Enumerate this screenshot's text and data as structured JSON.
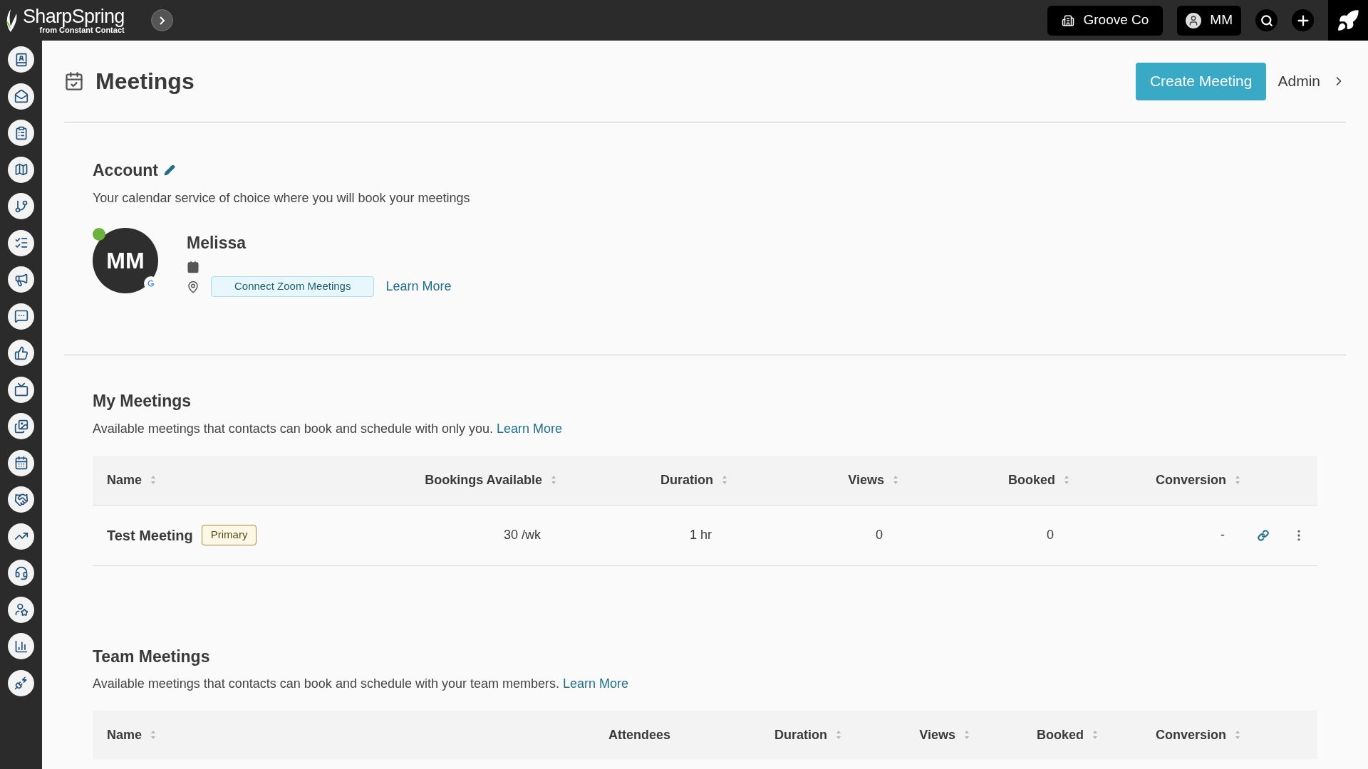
{
  "topbar": {
    "brand": "SharpSpring",
    "brand_sub": "from Constant Contact",
    "company": "Groove Co",
    "user": "MM"
  },
  "page": {
    "title": "Meetings",
    "create_button": "Create Meeting",
    "admin_link": "Admin"
  },
  "account": {
    "heading": "Account",
    "description": "Your calendar service of choice where you will book your meetings",
    "profile": {
      "initials": "MM",
      "name": "Melissa",
      "online": true,
      "connect_button": "Connect Zoom Meetings",
      "learn_more": "Learn More"
    }
  },
  "my_meetings": {
    "heading": "My Meetings",
    "description": "Available meetings that contacts can book and schedule with only you.",
    "learn_more": "Learn More",
    "columns": [
      {
        "label": "Name",
        "sortable": true
      },
      {
        "label": "Bookings Available",
        "sortable": true
      },
      {
        "label": "Duration",
        "sortable": true
      },
      {
        "label": "Views",
        "sortable": true
      },
      {
        "label": "Booked",
        "sortable": true
      },
      {
        "label": "Conversion",
        "sortable": true
      }
    ],
    "rows": [
      {
        "badge": "Primary",
        "cells": [
          "Test Meeting",
          "30 /wk",
          "1 hr",
          "0",
          "0",
          "-"
        ]
      }
    ]
  },
  "team_meetings": {
    "heading": "Team Meetings",
    "description": "Available meetings that contacts can book and schedule with your team members.",
    "learn_more": "Learn More",
    "columns": [
      {
        "label": "Name",
        "sortable": true
      },
      {
        "label": "Attendees",
        "sortable": false
      },
      {
        "label": "Duration",
        "sortable": true
      },
      {
        "label": "Views",
        "sortable": true
      },
      {
        "label": "Booked",
        "sortable": true
      },
      {
        "label": "Conversion",
        "sortable": true
      }
    ]
  }
}
